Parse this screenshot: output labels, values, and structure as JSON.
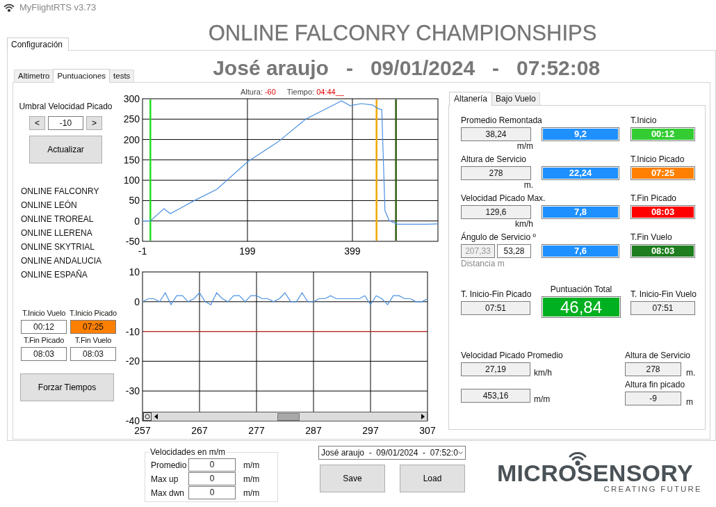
{
  "window": {
    "title": "MyFlightRTS v3.73"
  },
  "header": {
    "title": "ONLINE FALCONRY CHAMPIONSHIPS",
    "subtitle": "José araujo   -   09/01/2024   -   07:52:08"
  },
  "main_tabs": [
    {
      "label": "Configuración",
      "selected": true
    }
  ],
  "tabs": [
    {
      "label": "Altimetro",
      "selected": false
    },
    {
      "label": "Puntuaciones",
      "selected": true
    },
    {
      "label": "tests",
      "selected": false
    }
  ],
  "threshold": {
    "label": "Umbral Velocidad Picado",
    "decrement": "<",
    "value": "-10",
    "increment": ">",
    "update_button": "Actualizar"
  },
  "competitions": [
    "ONLINE FALCONRY",
    "ONLINE LEÓN",
    "ONLINE TROREAL",
    "ONLINE LLERENA",
    "ONLINE SKYTRIAL",
    "ONLINE ANDALUCIA",
    "ONLINE ESPAÑA"
  ],
  "times": [
    {
      "label": "T.Inicio Vuelo",
      "value": "00:12",
      "color": "#ffffff"
    },
    {
      "label": "T.Inicio Picado",
      "value": "07:25",
      "color": "#ff8000"
    },
    {
      "label": "T.Fin Picado",
      "value": "08:03",
      "color": "#ffffff"
    },
    {
      "label": "T.Fin Vuelo",
      "value": "08:03",
      "color": "#ffffff"
    }
  ],
  "force_button": "Forzar Tiempos",
  "altitude_chart": {
    "readout": [
      {
        "label": "Altura:",
        "value": "-60"
      },
      {
        "label": "Tiempo:",
        "value": "04:44__"
      }
    ],
    "chart_data": {
      "type": "line",
      "x": [
        -1,
        14,
        40,
        52,
        98,
        141,
        199,
        257,
        310,
        374,
        378,
        395,
        416,
        437,
        448,
        455,
        461,
        469,
        485,
        543,
        562
      ],
      "series": [
        {
          "color": "#4a90e2",
          "values": [
            0,
            0,
            30,
            18,
            50,
            78,
            145,
            194,
            250,
            292,
            295,
            283,
            288,
            285,
            276,
            273,
            25,
            1,
            -8,
            -8,
            -7
          ]
        }
      ],
      "xlim": [
        -1,
        562
      ],
      "ylim": [
        -50,
        300
      ],
      "xticks": [
        -1,
        199,
        399
      ],
      "yticks": [
        -50,
        0,
        50,
        100,
        150,
        200,
        250,
        300
      ],
      "grid": true,
      "ref_lines": [
        {
          "axis": "x",
          "value": 14,
          "color": "#22dd22"
        },
        {
          "axis": "x",
          "value": 445,
          "color": "#f0a800"
        },
        {
          "axis": "x",
          "value": 482,
          "color": "#2e5d10"
        }
      ]
    }
  },
  "speed_chart": {
    "chart_data": {
      "type": "line",
      "x": [
        257,
        258,
        259,
        260,
        261,
        262,
        263,
        264,
        265,
        266,
        267,
        268,
        269,
        270,
        271,
        272,
        273,
        274,
        275,
        276,
        277,
        278,
        279,
        280,
        281,
        282,
        283,
        284,
        285,
        286,
        287,
        288,
        289,
        290,
        291,
        292,
        293,
        294,
        295,
        296,
        297,
        298,
        299,
        300,
        301,
        302,
        303,
        304,
        305,
        306,
        307
      ],
      "series": [
        {
          "color": "#4a90e2",
          "values": [
            0,
            1,
            1,
            0,
            3,
            -1,
            2,
            2,
            0,
            1,
            3,
            0,
            -1,
            3,
            1,
            0,
            2,
            2,
            0,
            2,
            2,
            1,
            1,
            0,
            1,
            3,
            0,
            0,
            3,
            0,
            0,
            1,
            1,
            2,
            1,
            1,
            1,
            1,
            1,
            2,
            -1,
            2,
            1,
            -1,
            2,
            2,
            1,
            1,
            0,
            0,
            1
          ]
        }
      ],
      "xlim": [
        257,
        307
      ],
      "ylim": [
        -40,
        10
      ],
      "xticks": [
        257,
        267,
        277,
        287,
        297,
        307
      ],
      "yticks": [
        -40,
        -30,
        -20,
        -10,
        0,
        10
      ],
      "grid": true,
      "ref_lines": [
        {
          "axis": "y",
          "value": -10,
          "color": "#c02020"
        }
      ]
    }
  },
  "score_tabs": [
    {
      "label": "Altanería",
      "selected": true
    },
    {
      "label": "Bajo Vuelo",
      "selected": false
    }
  ],
  "metrics": [
    {
      "label": "Promedio Remontada",
      "fields": [
        {
          "value": "38,24",
          "readonly": true,
          "disabled": false
        }
      ],
      "unit": "m/m",
      "score": "9,2",
      "time_label": "T.Inicio",
      "time": {
        "value": "00:12",
        "color": "#33cc33"
      }
    },
    {
      "label": "Altura de Servicio",
      "fields": [
        {
          "value": "278",
          "readonly": true,
          "disabled": false
        }
      ],
      "unit": "m.",
      "score": "22,24",
      "time_label": "T.Inicio Picado",
      "time": {
        "value": "07:25",
        "color": "#ff8000"
      }
    },
    {
      "label": "Velocidad Picado Max.",
      "fields": [
        {
          "value": "129,6",
          "readonly": true,
          "disabled": false
        }
      ],
      "unit": "km/h",
      "score": "7,8",
      "time_label": "T.Fin Picado",
      "time": {
        "value": "08:03",
        "color": "#ff0000"
      }
    },
    {
      "label": "Ángulo de Servicio  º",
      "fields": [
        {
          "value": "207,33",
          "readonly": true,
          "disabled": true
        },
        {
          "value": "53,28",
          "readonly": false,
          "disabled": false
        }
      ],
      "note": "Distancia m",
      "score": "7,6",
      "time_label": "T.Fin Vuelo",
      "time": {
        "value": "08:03",
        "color": "#1e7d1e"
      }
    }
  ],
  "totals": {
    "dive_duration_label": "T. Inicio-Fin Picado",
    "dive_duration": "07:51",
    "total_label": "Puntuación Total",
    "total": "46,84",
    "flight_duration_label": "T. Inicio-Fin Vuelo",
    "flight_duration": "07:51"
  },
  "averages": [
    {
      "label": "Velocidad Picado Promedio",
      "value": "27,19",
      "unit": "km/h"
    },
    {
      "value": "453,16",
      "unit": "m/m"
    }
  ],
  "altitudes": [
    {
      "label": "Altura de Servicio",
      "value": "278",
      "unit": "m."
    },
    {
      "label": "Altura fin picado",
      "value": "-9",
      "unit": "m"
    }
  ],
  "velocities": {
    "title": "Velocidades en m/m",
    "rows": [
      {
        "label": "Promedio",
        "value": "0",
        "unit": "m/m"
      },
      {
        "label": "Max up",
        "value": "0",
        "unit": "m/m"
      },
      {
        "label": "Max dwn",
        "value": "0",
        "unit": "m/m"
      }
    ]
  },
  "session_select": {
    "value": "José araujo  -  09/01/2024  -  07:52:0"
  },
  "buttons": [
    "Save",
    "Load"
  ],
  "logo": {
    "name": "MICROSENSORY",
    "tagline": "CREATING FUTURE"
  }
}
